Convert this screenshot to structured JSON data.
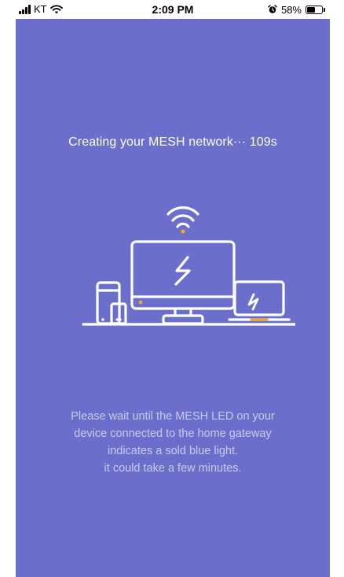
{
  "status_bar": {
    "carrier": "KT",
    "time": "2:09 PM",
    "battery_percent": "58%",
    "battery_level": 0.58,
    "icons": [
      "signal-icon",
      "wifi-icon",
      "alarm-icon",
      "battery-icon"
    ]
  },
  "screen": {
    "title": "Creating your MESH network··· 109s",
    "message_lines": [
      "Please wait until the MESH LED on your",
      "device connected to the home gateway",
      "indicates a sold blue light.",
      "it could take a few minutes."
    ],
    "illustration_icons": [
      "wifi-icon",
      "desktop-monitor-icon",
      "phone-icon",
      "laptop-icon",
      "lightning-icon"
    ]
  },
  "colors": {
    "background": "#6b6fcb",
    "line": "#ffffff",
    "accent": "#f0a830",
    "message_text": "#c9cbef"
  }
}
